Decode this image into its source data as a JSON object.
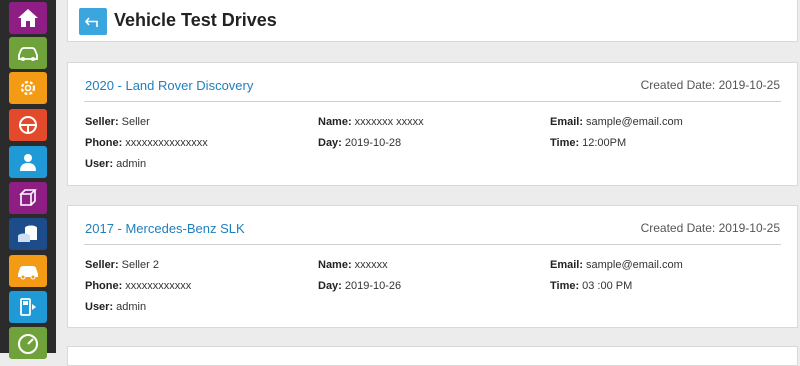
{
  "header": {
    "title": "Vehicle Test Drives"
  },
  "sidebar": {
    "items": [
      {
        "icon": "home-icon",
        "color": "#8e1e84"
      },
      {
        "icon": "car-icon",
        "color": "#6fa23a"
      },
      {
        "icon": "gear-icon",
        "color": "#f49b15"
      },
      {
        "icon": "steering-wheel-icon",
        "color": "#e34a2c"
      },
      {
        "icon": "user-icon",
        "color": "#1f9ad6"
      },
      {
        "icon": "box-icon",
        "color": "#8e1e84"
      },
      {
        "icon": "coins-icon",
        "color": "#1d4c8a"
      },
      {
        "icon": "car-icon",
        "color": "#f49b15"
      },
      {
        "icon": "fuel-pump-icon",
        "color": "#1f9ad6"
      },
      {
        "icon": "speedometer-icon",
        "color": "#6fa23a"
      }
    ]
  },
  "labels": {
    "seller": "Seller:",
    "phone": "Phone:",
    "user": "User:",
    "name": "Name:",
    "day": "Day:",
    "email": "Email:",
    "time": "Time:"
  },
  "drives": [
    {
      "title": "2020 - Land Rover Discovery",
      "created": "Created Date: 2019-10-25",
      "seller": "Seller",
      "phone": "xxxxxxxxxxxxxxx",
      "user": "admin",
      "name": "xxxxxxx xxxxx",
      "day": "2019-10-28",
      "email": "sample@email.com",
      "time": "12:00PM"
    },
    {
      "title": "2017 - Mercedes-Benz SLK",
      "created": "Created Date: 2019-10-25",
      "seller": "Seller 2",
      "phone": "xxxxxxxxxxxx",
      "user": "admin",
      "name": "xxxxxx",
      "day": "2019-10-26",
      "email": "sample@email.com",
      "time": "03 :00 PM"
    }
  ]
}
